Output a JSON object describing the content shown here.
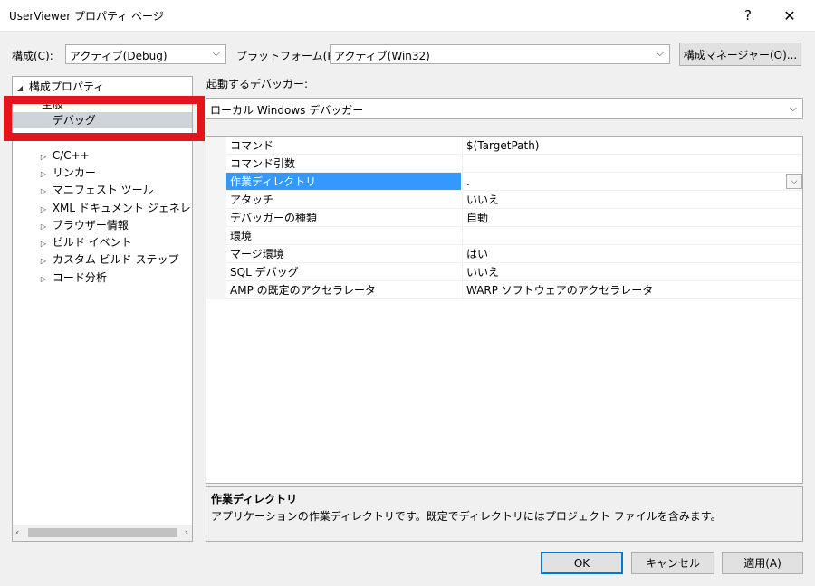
{
  "window": {
    "title": "UserViewer プロパティ ページ",
    "help": "?",
    "close": "✕"
  },
  "config": {
    "label": "構成(C):",
    "value": "アクティブ(Debug)"
  },
  "platform": {
    "label": "プラットフォーム(P):",
    "value": "アクティブ(Win32)"
  },
  "config_manager_label": "構成マネージャー(O)...",
  "tree": {
    "root": "構成プロパティ",
    "items": [
      {
        "label": "全般",
        "indent": 1,
        "expandable": false,
        "selected": false
      },
      {
        "label": "デバッグ",
        "indent": 1,
        "expandable": false,
        "selected": true
      },
      {
        "label": "C/C++",
        "indent": 1,
        "expandable": true,
        "selected": false
      },
      {
        "label": "リンカー",
        "indent": 1,
        "expandable": true,
        "selected": false
      },
      {
        "label": "マニフェスト ツール",
        "indent": 1,
        "expandable": true,
        "selected": false
      },
      {
        "label": "XML ドキュメント ジェネレーター",
        "indent": 1,
        "expandable": true,
        "selected": false
      },
      {
        "label": "ブラウザー情報",
        "indent": 1,
        "expandable": true,
        "selected": false
      },
      {
        "label": "ビルド イベント",
        "indent": 1,
        "expandable": true,
        "selected": false
      },
      {
        "label": "カスタム ビルド ステップ",
        "indent": 1,
        "expandable": true,
        "selected": false
      },
      {
        "label": "コード分析",
        "indent": 1,
        "expandable": true,
        "selected": false
      }
    ]
  },
  "debugger": {
    "label": "起動するデバッガー:",
    "value": "ローカル Windows デバッガー"
  },
  "properties": [
    {
      "name": "コマンド",
      "value": "$(TargetPath)"
    },
    {
      "name": "コマンド引数",
      "value": ""
    },
    {
      "name": "作業ディレクトリ",
      "value": ".",
      "selected": true
    },
    {
      "name": "アタッチ",
      "value": "いいえ"
    },
    {
      "name": "デバッガーの種類",
      "value": "自動"
    },
    {
      "name": "環境",
      "value": ""
    },
    {
      "name": "マージ環境",
      "value": "はい"
    },
    {
      "name": "SQL デバッグ",
      "value": "いいえ"
    },
    {
      "name": "AMP の既定のアクセラレータ",
      "value": "WARP ソフトウェアのアクセラレータ"
    }
  ],
  "description": {
    "title": "作業ディレクトリ",
    "text": "アプリケーションの作業ディレクトリです。既定でディレクトリにはプロジェクト ファイルを含みます。"
  },
  "buttons": {
    "ok": "OK",
    "cancel": "キャンセル",
    "apply": "適用(A)"
  },
  "colors": {
    "highlight": "#e3151a",
    "selection": "#3399ff"
  }
}
